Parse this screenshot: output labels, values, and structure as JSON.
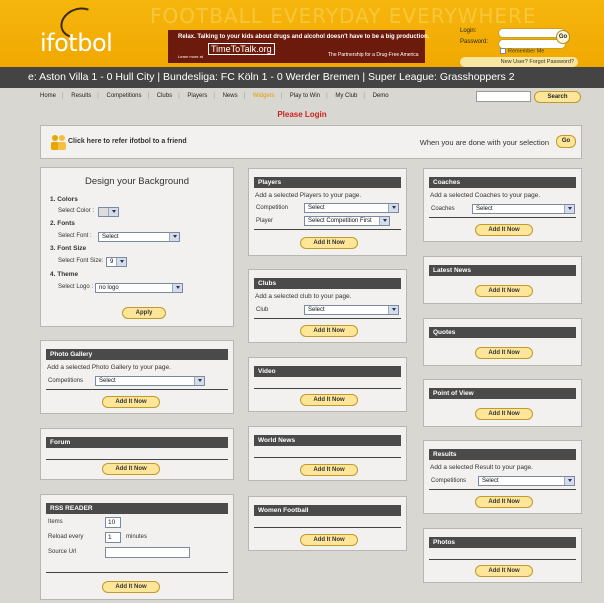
{
  "header": {
    "logo": "ifotbol",
    "tagline": "FOOTBALL EVERYDAY EVERYWHERE",
    "ad_line1": "Relax. Talking to your kids about drugs and alcohol doesn't have to be a big production.",
    "ad_logo": "TimeToTalk.org",
    "ad_line2": "The Partnership for a Drug-Free America",
    "ad_line3": "Learn more at"
  },
  "login": {
    "login_label": "Login:",
    "password_label": "Password:",
    "go": "Go",
    "remember": "Remember Me",
    "new_user": "New User? Forgot Password?"
  },
  "ticker": "e: Aston Villa 1 - 0 Hull City   |   Bundesliga: FC Köln 1 - 0 Werder Bremen   |   Super League: Grasshoppers 2",
  "nav": [
    "Home",
    "Results",
    "Competitions",
    "Clubs",
    "Players",
    "News",
    "Widgets",
    "Play to Win",
    "My Club",
    "Demo"
  ],
  "search_button": "Search",
  "please_login": "Please Login",
  "refer": {
    "text": "Click here to refer ifotbol to a friend",
    "done": "When you are done with your selection",
    "go": "Go"
  },
  "design": {
    "title": "Design your Background",
    "colors": "1. Colors",
    "select_color": "Select Color :",
    "fonts": "2. Fonts",
    "select_font": "Select Font :",
    "font_value": "Select",
    "font_size": "3. Font Size",
    "select_font_size": "Select Font Size:",
    "size_value": "9",
    "theme": "4. Theme",
    "select_logo": "Select Logo :",
    "logo_value": "no logo",
    "apply": "Apply"
  },
  "add_now": "Add It Now",
  "photo": {
    "title": "Photo Gallery",
    "desc": "Add a selected Photo Gallery to your page.",
    "label": "Competitions",
    "value": "Select"
  },
  "forum": {
    "title": "Forum"
  },
  "rss": {
    "title": "RSS READER",
    "items_label": "Items",
    "items": "10",
    "reload_label": "Reload every",
    "reload": "1",
    "minutes": "minutes",
    "source": "Source Url",
    "source_value": ""
  },
  "players": {
    "title": "Players",
    "desc": "Add a selected Players to your page.",
    "comp_label": "Competition",
    "comp_value": "Select",
    "player_label": "Player",
    "player_value": "Select Competition First"
  },
  "clubs": {
    "title": "Clubs",
    "desc": "Add a selected club to your page.",
    "label": "Club",
    "value": "Select"
  },
  "video": {
    "title": "Video"
  },
  "worldnews": {
    "title": "World News"
  },
  "women": {
    "title": "Women Football"
  },
  "coaches": {
    "title": "Coaches",
    "desc": "Add a selected Coaches to your page.",
    "label": "Coaches",
    "value": "Select"
  },
  "latest": {
    "title": "Latest News"
  },
  "quotes": {
    "title": "Quotes"
  },
  "pov": {
    "title": "Point of View"
  },
  "results": {
    "title": "Results",
    "desc": "Add a selected Result to your page.",
    "label": "Competitions",
    "value": "Select"
  },
  "photos": {
    "title": "Photos"
  }
}
